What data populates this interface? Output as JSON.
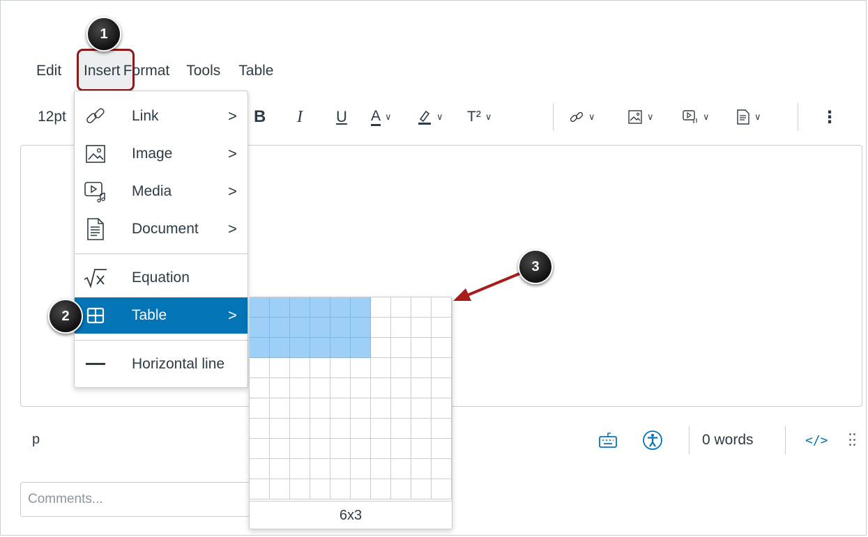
{
  "menubar": {
    "items": [
      "Edit",
      "Insert",
      "Format",
      "Tools",
      "Table"
    ]
  },
  "toolbar": {
    "font_size": "12pt",
    "bold": "B",
    "italic": "I",
    "underline": "U",
    "text_color": "A",
    "superscript": "T²",
    "more": "⋮",
    "icons": [
      "link-icon",
      "image-icon",
      "media-icon",
      "document-icon",
      "more-icon"
    ]
  },
  "insert_menu": {
    "items": [
      {
        "label": "Link",
        "icon": "link-icon",
        "has_submenu": true
      },
      {
        "label": "Image",
        "icon": "image-icon",
        "has_submenu": true
      },
      {
        "label": "Media",
        "icon": "media-icon",
        "has_submenu": true
      },
      {
        "label": "Document",
        "icon": "document-icon",
        "has_submenu": true
      },
      {
        "label": "Equation",
        "icon": "equation-icon",
        "has_submenu": false
      },
      {
        "label": "Table",
        "icon": "table-icon",
        "has_submenu": true,
        "active": true
      },
      {
        "label": "Horizontal line",
        "icon": "horizontal-line-icon",
        "has_submenu": false
      }
    ]
  },
  "table_picker": {
    "columns": 10,
    "rows": 10,
    "selected_columns": 6,
    "selected_rows": 3,
    "size_label": "6x3"
  },
  "statusbar": {
    "element_path": "p",
    "word_count": "0 words",
    "html_toggle": "</>"
  },
  "comments": {
    "placeholder": "Comments..."
  },
  "callouts": [
    "1",
    "2",
    "3"
  ],
  "colors": {
    "accent": "#0374b5",
    "grid_selected": "#9ecff6",
    "highlight_border": "#8b1a1a",
    "callout_arrow": "#a81c1c"
  }
}
